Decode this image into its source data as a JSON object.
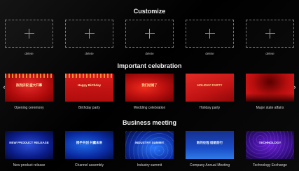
{
  "sections": {
    "customize": {
      "title": "Customize",
      "slots": [
        {
          "label": "delete"
        },
        {
          "label": "delete"
        },
        {
          "label": "delete"
        },
        {
          "label": "delete"
        },
        {
          "label": "delete"
        }
      ]
    },
    "celebration": {
      "title": "Important celebration",
      "items": [
        {
          "label": "Opening ceremony",
          "thumb_text": "热烈庆祝 盛大开幕"
        },
        {
          "label": "Birthday party",
          "thumb_text": "Happy Birthday"
        },
        {
          "label": "Wedding celebration",
          "thumb_text": "我们结婚了"
        },
        {
          "label": "Holiday party",
          "thumb_text": "HOLIDAY PARTY"
        },
        {
          "label": "Major state affairs",
          "thumb_text": ""
        }
      ]
    },
    "business": {
      "title": "Business meeting",
      "items": [
        {
          "label": "New product release",
          "thumb_text": "NEW PRODUCT RELEASE"
        },
        {
          "label": "Channel assembly",
          "thumb_text": "携手共创 共赢未来"
        },
        {
          "label": "Industry summit",
          "thumb_text": "INDUSTRY SUMMIT"
        },
        {
          "label": "Company Annual Meeting",
          "thumb_text": "新的征程 砥砺前行"
        },
        {
          "label": "Technology Exchange",
          "thumb_text": "TECHNOLOGY"
        }
      ]
    }
  },
  "navigation": {
    "left_arrow": "‹",
    "right_arrow": "›"
  },
  "colors": {
    "background": "#000000",
    "celebration_red": "#c21414",
    "business_blue": "#0b2a9c"
  }
}
